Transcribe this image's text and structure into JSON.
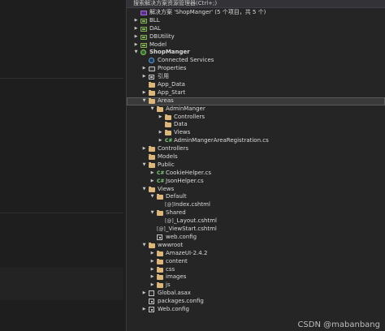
{
  "explorer": {
    "search_placeholder": "搜索解决方案资源管理器(Ctrl+;)"
  },
  "tree": [
    {
      "label": "解决方案 'ShopManger' (5 个项目，共 5 个)",
      "icon": "solution-icon",
      "depth": 0,
      "arrow": "",
      "bold": false,
      "selected": false
    },
    {
      "label": "BLL",
      "icon": "csharp-project-icon",
      "depth": 0,
      "arrow": "collapsed",
      "bold": false,
      "selected": false
    },
    {
      "label": "DAL",
      "icon": "csharp-project-icon",
      "depth": 0,
      "arrow": "collapsed",
      "bold": false,
      "selected": false
    },
    {
      "label": "DBUtility",
      "icon": "csharp-project-icon",
      "depth": 0,
      "arrow": "collapsed",
      "bold": false,
      "selected": false
    },
    {
      "label": "Model",
      "icon": "csharp-project-icon",
      "depth": 0,
      "arrow": "collapsed",
      "bold": false,
      "selected": false
    },
    {
      "label": "ShopManger",
      "icon": "web-project-icon",
      "depth": 0,
      "arrow": "expanded",
      "bold": true,
      "selected": false
    },
    {
      "label": "Connected Services",
      "icon": "connected-services-icon",
      "depth": 1,
      "arrow": "",
      "bold": false,
      "selected": false
    },
    {
      "label": "Properties",
      "icon": "properties-icon",
      "depth": 1,
      "arrow": "collapsed",
      "bold": false,
      "selected": false
    },
    {
      "label": "引用",
      "icon": "references-icon",
      "depth": 1,
      "arrow": "collapsed",
      "bold": false,
      "selected": false
    },
    {
      "label": "App_Data",
      "icon": "folder-icon",
      "depth": 1,
      "arrow": "",
      "bold": false,
      "selected": false
    },
    {
      "label": "App_Start",
      "icon": "folder-icon",
      "depth": 1,
      "arrow": "collapsed",
      "bold": false,
      "selected": false
    },
    {
      "label": "Areas",
      "icon": "folder-icon",
      "depth": 1,
      "arrow": "expanded",
      "bold": false,
      "selected": true
    },
    {
      "label": "AdminManger",
      "icon": "folder-icon",
      "depth": 2,
      "arrow": "expanded",
      "bold": false,
      "selected": false
    },
    {
      "label": "Controllers",
      "icon": "folder-icon",
      "depth": 3,
      "arrow": "collapsed",
      "bold": false,
      "selected": false
    },
    {
      "label": "Data",
      "icon": "folder-icon",
      "depth": 3,
      "arrow": "",
      "bold": false,
      "selected": false
    },
    {
      "label": "Views",
      "icon": "folder-icon",
      "depth": 3,
      "arrow": "collapsed",
      "bold": false,
      "selected": false
    },
    {
      "label": "AdminMangerAreaRegistration.cs",
      "icon": "csharp-file-icon",
      "depth": 3,
      "arrow": "collapsed",
      "bold": false,
      "selected": false
    },
    {
      "label": "Controllers",
      "icon": "folder-icon",
      "depth": 1,
      "arrow": "collapsed",
      "bold": false,
      "selected": false
    },
    {
      "label": "Models",
      "icon": "folder-icon",
      "depth": 1,
      "arrow": "",
      "bold": false,
      "selected": false
    },
    {
      "label": "Public",
      "icon": "folder-icon",
      "depth": 1,
      "arrow": "expanded",
      "bold": false,
      "selected": false
    },
    {
      "label": "CookieHelper.cs",
      "icon": "csharp-file-icon",
      "depth": 2,
      "arrow": "collapsed",
      "bold": false,
      "selected": false
    },
    {
      "label": "JsonHelper.cs",
      "icon": "csharp-file-icon",
      "depth": 2,
      "arrow": "collapsed",
      "bold": false,
      "selected": false
    },
    {
      "label": "Views",
      "icon": "folder-icon",
      "depth": 1,
      "arrow": "expanded",
      "bold": false,
      "selected": false
    },
    {
      "label": "Default",
      "icon": "folder-icon",
      "depth": 2,
      "arrow": "expanded",
      "bold": false,
      "selected": false
    },
    {
      "label": "Index.cshtml",
      "icon": "cshtml-file-icon",
      "depth": 3,
      "arrow": "",
      "bold": false,
      "selected": false
    },
    {
      "label": "Shared",
      "icon": "folder-icon",
      "depth": 2,
      "arrow": "expanded",
      "bold": false,
      "selected": false
    },
    {
      "label": "_Layout.cshtml",
      "icon": "cshtml-file-icon",
      "depth": 3,
      "arrow": "",
      "bold": false,
      "selected": false
    },
    {
      "label": "_ViewStart.cshtml",
      "icon": "cshtml-file-icon",
      "depth": 2,
      "arrow": "",
      "bold": false,
      "selected": false
    },
    {
      "label": "web.config",
      "icon": "config-file-icon",
      "depth": 2,
      "arrow": "",
      "bold": false,
      "selected": false
    },
    {
      "label": "wwwroot",
      "icon": "folder-icon",
      "depth": 1,
      "arrow": "expanded",
      "bold": false,
      "selected": false
    },
    {
      "label": "AmazeUI-2.4.2",
      "icon": "folder-icon",
      "depth": 2,
      "arrow": "collapsed",
      "bold": false,
      "selected": false
    },
    {
      "label": "content",
      "icon": "folder-icon",
      "depth": 2,
      "arrow": "collapsed",
      "bold": false,
      "selected": false
    },
    {
      "label": "css",
      "icon": "folder-icon",
      "depth": 2,
      "arrow": "collapsed",
      "bold": false,
      "selected": false
    },
    {
      "label": "images",
      "icon": "folder-icon",
      "depth": 2,
      "arrow": "collapsed",
      "bold": false,
      "selected": false
    },
    {
      "label": "js",
      "icon": "folder-icon",
      "depth": 2,
      "arrow": "collapsed",
      "bold": false,
      "selected": false
    },
    {
      "label": "Global.asax",
      "icon": "asax-file-icon",
      "depth": 1,
      "arrow": "collapsed",
      "bold": false,
      "selected": false
    },
    {
      "label": "packages.config",
      "icon": "config-file-icon",
      "depth": 1,
      "arrow": "",
      "bold": false,
      "selected": false
    },
    {
      "label": "Web.config",
      "icon": "config-file-icon",
      "depth": 1,
      "arrow": "collapsed",
      "bold": false,
      "selected": false
    }
  ],
  "icon_glyphs": {
    "csharp-file-icon": "C#",
    "cshtml-file-icon": "[@]"
  },
  "colors": {
    "background": "#1e1e1e",
    "panel": "#252526",
    "folder": "#dcb67a",
    "selection": "#3a3a3a"
  },
  "watermark": "CSDN @mabanbang"
}
